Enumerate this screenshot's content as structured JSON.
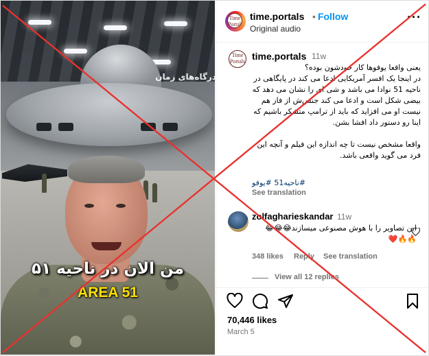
{
  "media": {
    "watermark": "درگاه‌های زمان",
    "caption_fa": "من الان در ناحیه ۵۱",
    "caption_en": "AREA 51"
  },
  "header": {
    "username": "time.portals",
    "dot": "•",
    "follow_label": "Follow",
    "audio_label": "Original audio",
    "more_label": "···",
    "avatar_text": "Time Portals"
  },
  "post": {
    "username": "time.portals",
    "time": "11w",
    "text": "یعنی واقعا یوفوها کار خودشون بوده؟\nدر اینجا یک افسر آمریکایی ادعا می کند در پایگاهی در ناحیه 51 نوادا می باشد و شی ای را نشان می دهد که بیضی شکل است و ادعا می کند جنس‌ش از فاز هم نیست او می افزاید که باید از ترامپ متشکر باشیم که اینا رو دستور داد افشا بشن.\n\nواقعا مشخص نیست تا چه اندازه این فیلم و آنچه این فرد می گوید واقعی باشد.",
    "hashtags": "#ناحیه51 #یوفو",
    "see_translation": "See translation"
  },
  "comment": {
    "username": "zolfagharieskandar",
    "time": "11w",
    "text": "این تصاویر را با هوش مصنوعی میسازند😂😂😂\n🔥🔥❤️",
    "likes": "348 likes",
    "reply": "Reply",
    "see_translation": "See translation",
    "view_replies": "View all 12 replies"
  },
  "footer": {
    "likes": "70,446 likes",
    "date": "March 5"
  },
  "colors": {
    "accent": "#0095f6",
    "muted": "#737373",
    "cross": "#e8322f"
  }
}
